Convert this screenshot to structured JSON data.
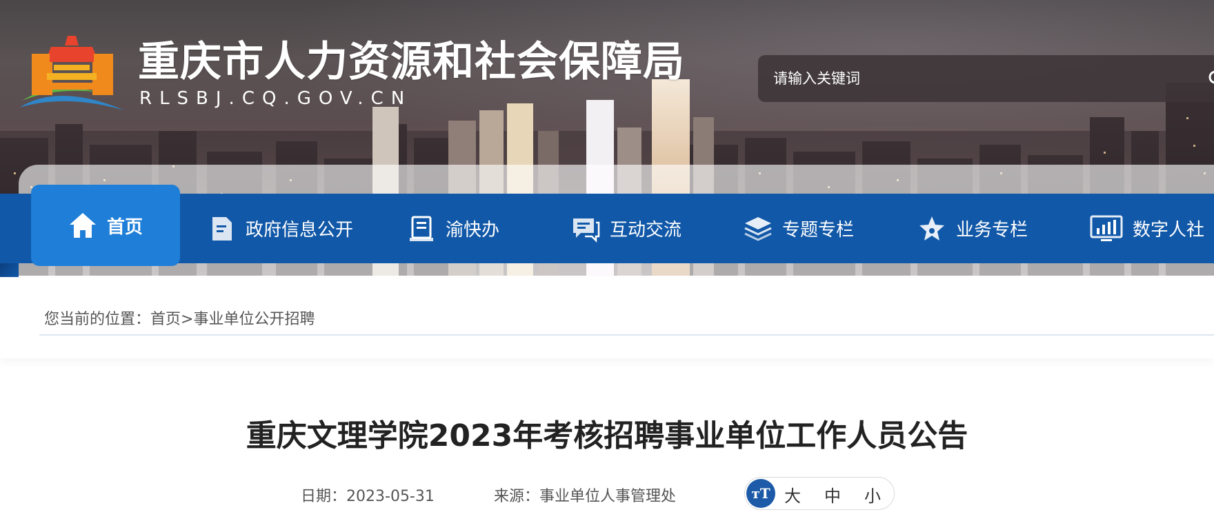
{
  "header": {
    "site_title": "重庆市人力资源和社会保障局",
    "site_domain": "RLSBJ.CQ.GOV.CN",
    "logo_icon": "tiantan-logo-icon"
  },
  "search": {
    "placeholder": "请输入关键词",
    "icon": "search-icon"
  },
  "nav": {
    "items": [
      {
        "label": "首页",
        "icon": "home-icon",
        "active": true
      },
      {
        "label": "政府信息公开",
        "icon": "document-icon"
      },
      {
        "label": "渝快办",
        "icon": "clipboard-icon"
      },
      {
        "label": "互动交流",
        "icon": "chat-icon"
      },
      {
        "label": "专题专栏",
        "icon": "layers-icon"
      },
      {
        "label": "业务专栏",
        "icon": "star-icon"
      },
      {
        "label": "数字人社",
        "icon": "monitor-chart-icon"
      }
    ]
  },
  "breadcrumb": {
    "prefix": "您当前的位置：",
    "home": "首页",
    "separator": ">",
    "current": "事业单位公开招聘"
  },
  "article": {
    "title": "重庆文理学院2023年考核招聘事业单位工作人员公告",
    "date_label": "日期：",
    "date": "2023-05-31",
    "source_label": "来源：",
    "source": "事业单位人事管理处"
  },
  "font_size": {
    "icon_text": "тT",
    "large": "大",
    "medium": "中",
    "small": "小"
  },
  "colors": {
    "nav_bg": "#1158a8",
    "nav_active": "#1e7ed8",
    "fontsize_icon": "#1d5ba8"
  }
}
